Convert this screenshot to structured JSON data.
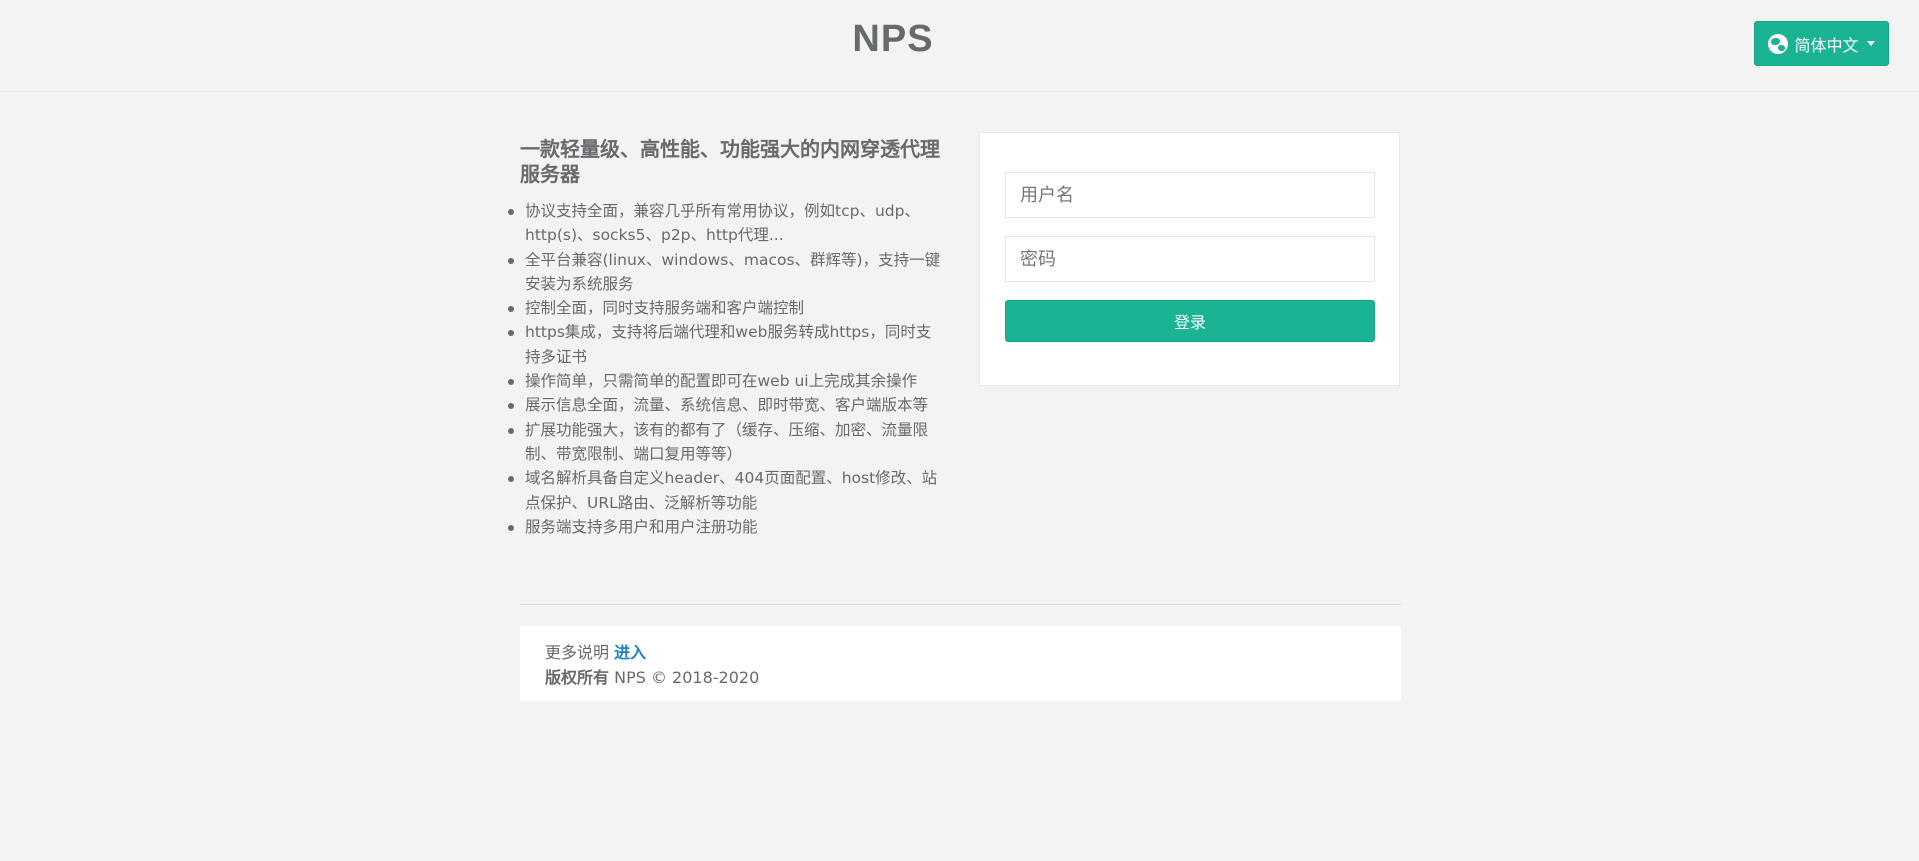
{
  "header": {
    "brand": "NPS",
    "language_button_label": "简体中文",
    "language_icon": "globe-icon"
  },
  "features": {
    "headline": "一款轻量级、高性能、功能强大的内网穿透代理服务器",
    "items": [
      "协议支持全面，兼容几乎所有常用协议，例如tcp、udp、http(s)、socks5、p2p、http代理...",
      "全平台兼容(linux、windows、macos、群辉等)，支持一键安装为系统服务",
      "控制全面，同时支持服务端和客户端控制",
      "https集成，支持将后端代理和web服务转成https，同时支持多证书",
      "操作简单，只需简单的配置即可在web ui上完成其余操作",
      "展示信息全面，流量、系统信息、即时带宽、客户端版本等",
      "扩展功能强大，该有的都有了（缓存、压缩、加密、流量限制、带宽限制、端口复用等等）",
      "域名解析具备自定义header、404页面配置、host修改、站点保护、URL路由、泛解析等功能",
      "服务端支持多用户和用户注册功能"
    ]
  },
  "login": {
    "username_placeholder": "用户名",
    "password_placeholder": "密码",
    "submit_label": "登录"
  },
  "footer": {
    "more_label": "更多说明",
    "more_link": "进入",
    "copyright_label": "版权所有",
    "copyright_text": "NPS © 2018-2020"
  },
  "colors": {
    "accent": "#1ab394",
    "link": "#1c84c6",
    "text": "#676a6c",
    "background": "#f3f3f4"
  }
}
